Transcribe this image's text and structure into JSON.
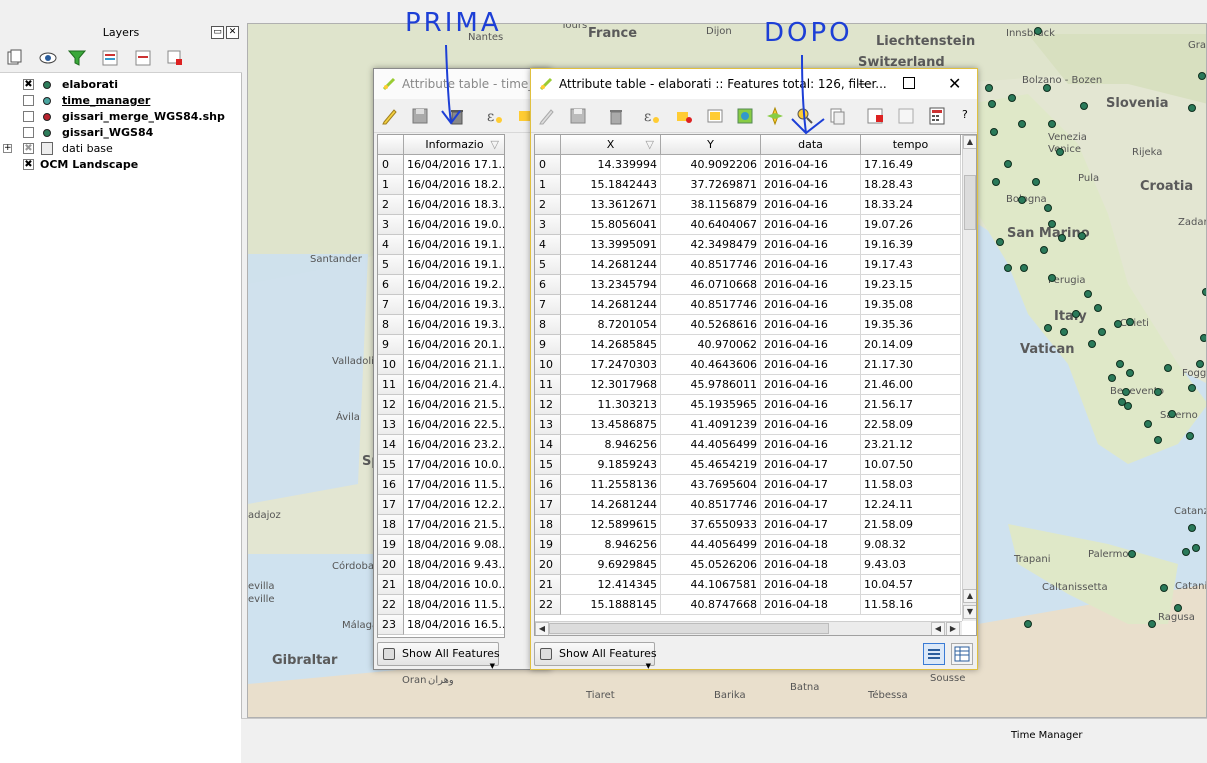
{
  "layers_panel": {
    "title": "Layers",
    "layers": [
      {
        "name": "elaborati",
        "checked": true,
        "dot_color": "#2e7d5b",
        "underline": false
      },
      {
        "name": "time_manager",
        "checked": false,
        "dot_color": "#4aa5a0",
        "underline": true
      },
      {
        "name": "gissari_merge_WGS84.shp",
        "checked": false,
        "dot_color": "#b8232f",
        "underline": false
      },
      {
        "name": "gissari_WGS84",
        "checked": false,
        "dot_color": "#2e7d5b",
        "underline": false
      },
      {
        "name": "dati base",
        "checked": false,
        "group": true
      },
      {
        "name": "OCM Landscape",
        "checked": true
      }
    ]
  },
  "map": {
    "labels": [
      "Tours",
      "Nantes",
      "Dijon",
      "Innsbruck",
      "Liechtenstein",
      "Switzerland",
      "Graz",
      "France",
      "Slovenia",
      "Bolzano - Bozen",
      "Venezia",
      "Venice",
      "Rijeka",
      "Croatia",
      "Pula",
      "Bologna",
      "San Marino",
      "Zadar",
      "Santander",
      "Perugia",
      "Italy",
      "Chieti",
      "Vatican",
      "Foggia",
      "Valladolid",
      "Benevento",
      "Ávila",
      "Salerno",
      "Sp",
      "adajoz",
      "Catanzaro",
      "Córdoba",
      "Trapani",
      "Palermo",
      "Caltanissetta",
      "Catania",
      "evilla",
      "eville",
      "Málaga",
      "Ragusa",
      "Gibraltar",
      "Oran",
      "وهران",
      "Tiaret",
      "Barika",
      "Batna",
      "Tébessa",
      "Sousse"
    ]
  },
  "status_bar": {
    "time_manager": "Time Manager"
  },
  "annotations": {
    "prima": "PRIMA",
    "dopo": "DOPO"
  },
  "win_back": {
    "title": "Attribute table - time_m",
    "column": "Informazio",
    "rows": [
      "16/04/2016 17.1...",
      "16/04/2016 18.2...",
      "16/04/2016 18.3...",
      "16/04/2016 19.0...",
      "16/04/2016 19.1...",
      "16/04/2016 19.1...",
      "16/04/2016 19.2...",
      "16/04/2016 19.3...",
      "16/04/2016 19.3...",
      "16/04/2016 20.1...",
      "16/04/2016 21.1...",
      "16/04/2016 21.4...",
      "16/04/2016 21.5...",
      "16/04/2016 22.5...",
      "16/04/2016 23.2...",
      "17/04/2016 10.0...",
      "17/04/2016 11.5...",
      "17/04/2016 12.2...",
      "17/04/2016 21.5...",
      "18/04/2016 9.08...",
      "18/04/2016 9.43...",
      "18/04/2016 10.0...",
      "18/04/2016 11.5...",
      "18/04/2016 16.5..."
    ],
    "show_all": "Show All Features"
  },
  "win_front": {
    "title": "Attribute table - elaborati :: Features total: 126, filter...",
    "columns": [
      "X",
      "Y",
      "data",
      "tempo"
    ],
    "rows": [
      [
        "14.339994",
        "40.9092206",
        "2016-04-16",
        "17.16.49"
      ],
      [
        "15.1842443",
        "37.7269871",
        "2016-04-16",
        "18.28.43"
      ],
      [
        "13.3612671",
        "38.1156879",
        "2016-04-16",
        "18.33.24"
      ],
      [
        "15.8056041",
        "40.6404067",
        "2016-04-16",
        "19.07.26"
      ],
      [
        "13.3995091",
        "42.3498479",
        "2016-04-16",
        "19.16.39"
      ],
      [
        "14.2681244",
        "40.8517746",
        "2016-04-16",
        "19.17.43"
      ],
      [
        "13.2345794",
        "46.0710668",
        "2016-04-16",
        "19.23.15"
      ],
      [
        "14.2681244",
        "40.8517746",
        "2016-04-16",
        "19.35.08"
      ],
      [
        "8.7201054",
        "40.5268616",
        "2016-04-16",
        "19.35.36"
      ],
      [
        "14.2685845",
        "40.970062",
        "2016-04-16",
        "20.14.09"
      ],
      [
        "17.2470303",
        "40.4643606",
        "2016-04-16",
        "21.17.30"
      ],
      [
        "12.3017968",
        "45.9786011",
        "2016-04-16",
        "21.46.00"
      ],
      [
        "11.303213",
        "45.1935965",
        "2016-04-16",
        "21.56.17"
      ],
      [
        "13.4586875",
        "41.4091239",
        "2016-04-16",
        "22.58.09"
      ],
      [
        "8.946256",
        "44.4056499",
        "2016-04-16",
        "23.21.12"
      ],
      [
        "9.1859243",
        "45.4654219",
        "2016-04-17",
        "10.07.50"
      ],
      [
        "11.2558136",
        "43.7695604",
        "2016-04-17",
        "11.58.03"
      ],
      [
        "14.2681244",
        "40.8517746",
        "2016-04-17",
        "12.24.11"
      ],
      [
        "12.5899615",
        "37.6550933",
        "2016-04-17",
        "21.58.09"
      ],
      [
        "8.946256",
        "44.4056499",
        "2016-04-18",
        "9.08.32"
      ],
      [
        "9.6929845",
        "45.0526206",
        "2016-04-18",
        "9.43.03"
      ],
      [
        "12.414345",
        "44.1067581",
        "2016-04-18",
        "10.04.57"
      ],
      [
        "15.1888145",
        "40.8747668",
        "2016-04-18",
        "11.58.16"
      ]
    ],
    "show_all": "Show All Features",
    "help": "?"
  }
}
